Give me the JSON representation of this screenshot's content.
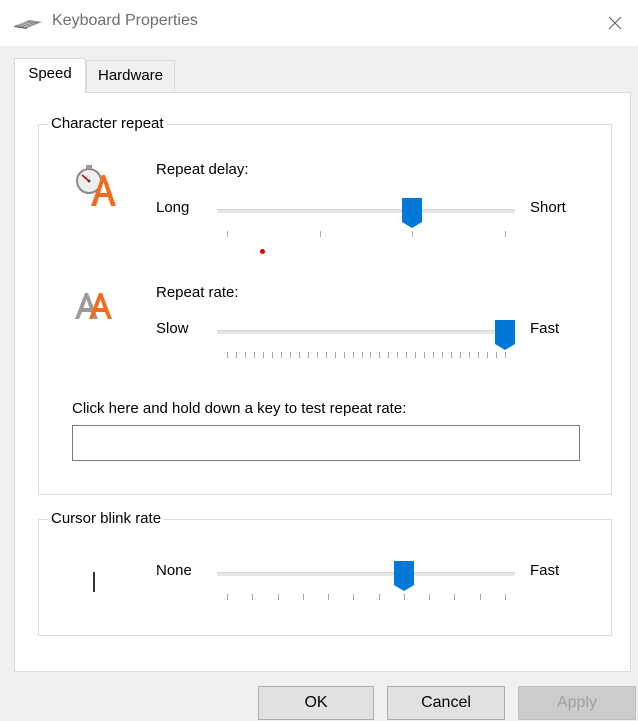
{
  "window": {
    "title": "Keyboard Properties",
    "close_glyph": "✕"
  },
  "tabs": [
    {
      "label": "Speed",
      "active": true
    },
    {
      "label": "Hardware",
      "active": false
    }
  ],
  "character_repeat": {
    "legend": "Character repeat",
    "repeat_delay": {
      "label": "Repeat delay:",
      "min_label": "Long",
      "max_label": "Short",
      "value": 2,
      "max": 3
    },
    "repeat_rate": {
      "label": "Repeat rate:",
      "min_label": "Slow",
      "max_label": "Fast",
      "value": 31,
      "max": 31
    },
    "test_label": "Click here and hold down a key to test repeat rate:",
    "test_value": ""
  },
  "cursor_blink": {
    "legend": "Cursor blink rate",
    "min_label": "None",
    "max_label": "Fast",
    "value": 7,
    "max": 11
  },
  "buttons": {
    "ok": "OK",
    "cancel": "Cancel",
    "apply": "Apply"
  },
  "colors": {
    "accent": "#0078d7",
    "icon_orange": "#f26b1d",
    "icon_gray": "#9a9a9a"
  },
  "icons": [
    "keyboard-icon",
    "close-icon",
    "stopwatch-letter-icon",
    "double-letter-icon",
    "text-cursor-icon"
  ]
}
